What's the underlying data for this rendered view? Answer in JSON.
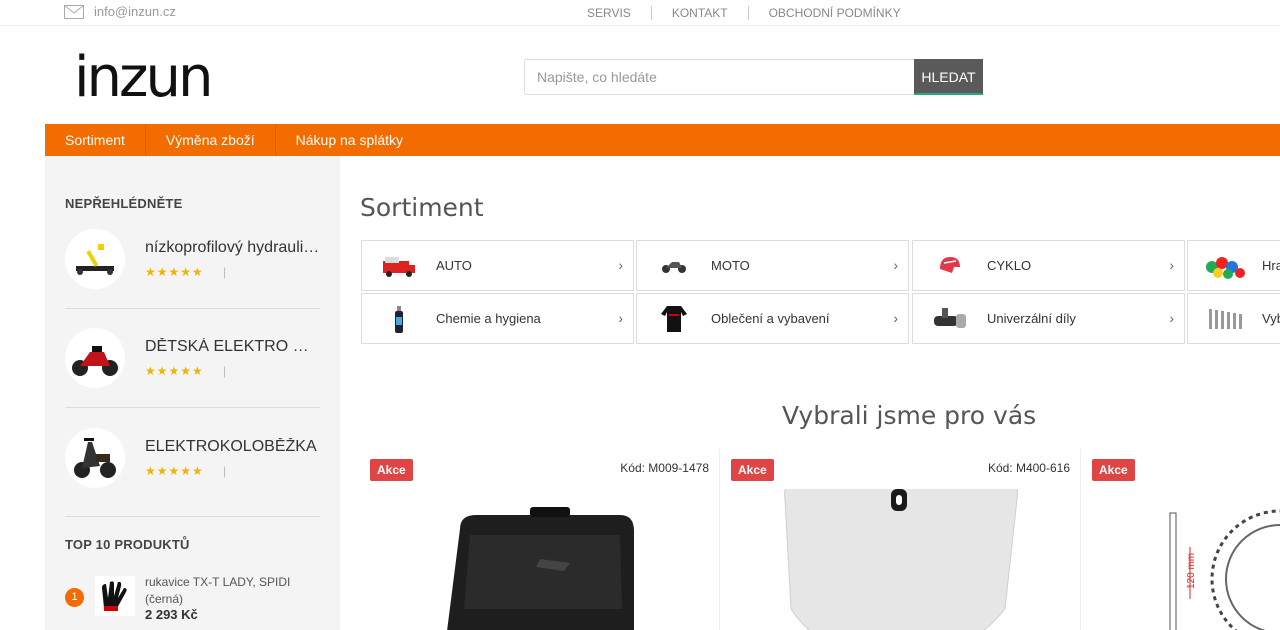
{
  "topbar": {
    "email": "info@inzun.cz",
    "links": [
      "SERVIS",
      "KONTAKT",
      "OBCHODNÍ PODMÍNKY"
    ]
  },
  "header": {
    "logo": "inzun",
    "search_placeholder": "Napište, co hledáte",
    "search_button": "HLEDAT"
  },
  "nav": [
    "Sortiment",
    "Výměna zboží",
    "Nákup na splátky"
  ],
  "sidebar": {
    "featured_heading": "NEPŘEHLÉDNĚTE",
    "featured": [
      {
        "name": "nízkoprofilový hydraulický zvedák",
        "stars": "★★★★★",
        "sep": "|"
      },
      {
        "name": "DĚTSKÁ ELEKTRO MOTORKA",
        "stars": "★★★★★",
        "sep": "|"
      },
      {
        "name": "ELEKTROKOLOBĚŽKA",
        "stars": "★★★★★",
        "sep": "|"
      }
    ],
    "top10_heading": "TOP 10 PRODUKTŮ",
    "top10": [
      {
        "rank": "1",
        "name": "rukavice TX-T LADY, SPIDI (černá)",
        "price": "2 293 Kč"
      }
    ]
  },
  "main": {
    "title": "Sortiment",
    "categories": [
      {
        "label": "AUTO",
        "icon": "car-icon"
      },
      {
        "label": "MOTO",
        "icon": "motorcycle-icon"
      },
      {
        "label": "CYKLO",
        "icon": "bicycle-helmet-icon"
      },
      {
        "label": "Hračky",
        "icon": "toys-icon"
      },
      {
        "label": "Chemie a hygiena",
        "icon": "spray-can-icon"
      },
      {
        "label": "Oblečení a vybavení",
        "icon": "clothing-icon"
      },
      {
        "label": "Univerzální díly",
        "icon": "parts-icon"
      },
      {
        "label": "Vybavení dílny",
        "icon": "tools-icon"
      }
    ],
    "chevron": "›",
    "picks_title": "Vybrali jsme pro vás",
    "products": [
      {
        "badge": "Akce",
        "code": "Kód: M009-1478"
      },
      {
        "badge": "Akce",
        "code": "Kód: M400-616"
      },
      {
        "badge": "Akce",
        "code": ""
      }
    ]
  }
}
